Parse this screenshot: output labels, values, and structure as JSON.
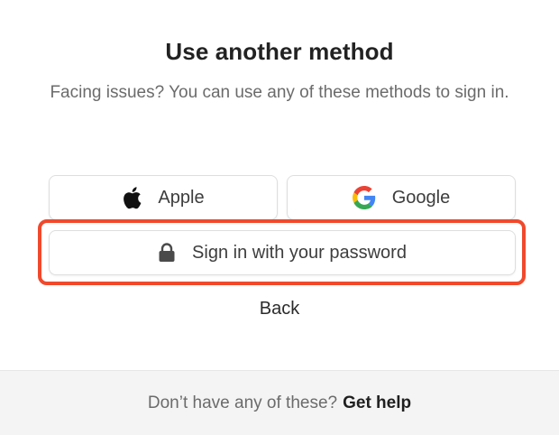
{
  "dialog": {
    "title": "Use another method",
    "subtitle": "Facing issues? You can use any of these methods to sign in."
  },
  "methods": {
    "apple": {
      "label": "Apple",
      "icon": "apple-icon"
    },
    "google": {
      "label": "Google",
      "icon": "google-icon"
    },
    "password": {
      "label": "Sign in with your password",
      "icon": "lock-icon"
    }
  },
  "back_label": "Back",
  "footer": {
    "question": "Don’t have any of these?",
    "link": "Get help"
  },
  "colors": {
    "highlight": "#f0492c",
    "google_blue": "#4285F4",
    "google_red": "#EA4335",
    "google_yellow": "#FBBC05",
    "google_green": "#34A853"
  }
}
